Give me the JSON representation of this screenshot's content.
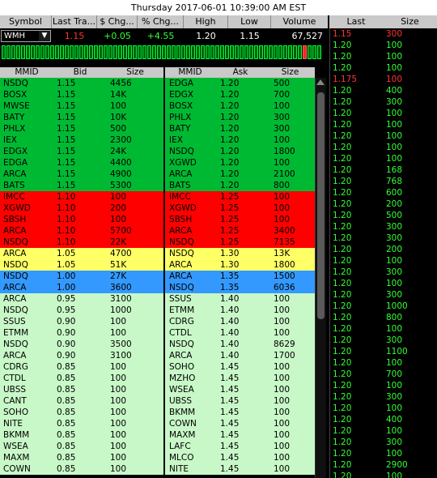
{
  "window": {
    "title": "Thursday 2017-06-01 10:39:00 AM EST"
  },
  "quote": {
    "headers": [
      "Symbol",
      "Last Tra...",
      "$ Chg...",
      "% Chg...",
      "High",
      "Low",
      "Volume"
    ],
    "symbol": "WMH",
    "last": "1.15",
    "chg": "+0.05",
    "pct": "+4.55",
    "high": "1.20",
    "low": "1.15",
    "volume": "67,527"
  },
  "colors": {
    "level1": "#00b933",
    "level2": "#ff0000",
    "level3": "#ffff66",
    "level4": "#3399ff",
    "level5": "#c8f8c8",
    "tick_green": "#00ff44",
    "tick_red": "#ff2222"
  },
  "time_sales": {
    "headers": [
      "Last",
      "Size"
    ],
    "rows": [
      {
        "last": "1.15",
        "size": "300",
        "c": "r"
      },
      {
        "last": "1.20",
        "size": "100",
        "c": "g"
      },
      {
        "last": "1.20",
        "size": "100",
        "c": "g"
      },
      {
        "last": "1.20",
        "size": "100",
        "c": "g"
      },
      {
        "last": "1.175",
        "size": "100",
        "c": "r"
      },
      {
        "last": "1.20",
        "size": "400",
        "c": "g"
      },
      {
        "last": "1.20",
        "size": "300",
        "c": "g"
      },
      {
        "last": "1.20",
        "size": "100",
        "c": "g"
      },
      {
        "last": "1.20",
        "size": "100",
        "c": "g"
      },
      {
        "last": "1.20",
        "size": "100",
        "c": "g"
      },
      {
        "last": "1.20",
        "size": "100",
        "c": "g"
      },
      {
        "last": "1.20",
        "size": "100",
        "c": "g"
      },
      {
        "last": "1.20",
        "size": "168",
        "c": "g"
      },
      {
        "last": "1.20",
        "size": "768",
        "c": "g"
      },
      {
        "last": "1.20",
        "size": "600",
        "c": "g"
      },
      {
        "last": "1.20",
        "size": "200",
        "c": "g"
      },
      {
        "last": "1.20",
        "size": "500",
        "c": "g"
      },
      {
        "last": "1.20",
        "size": "300",
        "c": "g"
      },
      {
        "last": "1.20",
        "size": "300",
        "c": "g"
      },
      {
        "last": "1.20",
        "size": "200",
        "c": "g"
      },
      {
        "last": "1.20",
        "size": "100",
        "c": "g"
      },
      {
        "last": "1.20",
        "size": "300",
        "c": "g"
      },
      {
        "last": "1.20",
        "size": "100",
        "c": "g"
      },
      {
        "last": "1.20",
        "size": "300",
        "c": "g"
      },
      {
        "last": "1.20",
        "size": "1000",
        "c": "g"
      },
      {
        "last": "1.20",
        "size": "800",
        "c": "g"
      },
      {
        "last": "1.20",
        "size": "100",
        "c": "g"
      },
      {
        "last": "1.20",
        "size": "300",
        "c": "g"
      },
      {
        "last": "1.20",
        "size": "1100",
        "c": "g"
      },
      {
        "last": "1.20",
        "size": "100",
        "c": "g"
      },
      {
        "last": "1.20",
        "size": "700",
        "c": "g"
      },
      {
        "last": "1.20",
        "size": "100",
        "c": "g"
      },
      {
        "last": "1.20",
        "size": "300",
        "c": "g"
      },
      {
        "last": "1.20",
        "size": "100",
        "c": "g"
      },
      {
        "last": "1.20",
        "size": "400",
        "c": "g"
      },
      {
        "last": "1.20",
        "size": "100",
        "c": "g"
      },
      {
        "last": "1.20",
        "size": "300",
        "c": "g"
      },
      {
        "last": "1.20",
        "size": "100",
        "c": "g"
      },
      {
        "last": "1.20",
        "size": "2900",
        "c": "g"
      },
      {
        "last": "1.20",
        "size": "100",
        "c": "g"
      }
    ]
  },
  "bid_book": {
    "headers": [
      "MMID",
      "Bid",
      "Size"
    ],
    "rows": [
      {
        "mmid": "NSDQ",
        "price": "1.15",
        "size": "4456",
        "lvl": 1
      },
      {
        "mmid": "BOSX",
        "price": "1.15",
        "size": "14K",
        "lvl": 1
      },
      {
        "mmid": "MWSE",
        "price": "1.15",
        "size": "100",
        "lvl": 1
      },
      {
        "mmid": "BATY",
        "price": "1.15",
        "size": "10K",
        "lvl": 1
      },
      {
        "mmid": "PHLX",
        "price": "1.15",
        "size": "500",
        "lvl": 1
      },
      {
        "mmid": "IEX",
        "price": "1.15",
        "size": "2300",
        "lvl": 1
      },
      {
        "mmid": "EDGX",
        "price": "1.15",
        "size": "24K",
        "lvl": 1
      },
      {
        "mmid": "EDGA",
        "price": "1.15",
        "size": "4400",
        "lvl": 1
      },
      {
        "mmid": "ARCA",
        "price": "1.15",
        "size": "4900",
        "lvl": 1
      },
      {
        "mmid": "BATS",
        "price": "1.15",
        "size": "5300",
        "lvl": 1
      },
      {
        "mmid": "IMCC",
        "price": "1.10",
        "size": "100",
        "lvl": 2
      },
      {
        "mmid": "XGWD",
        "price": "1.10",
        "size": "200",
        "lvl": 2
      },
      {
        "mmid": "SBSH",
        "price": "1.10",
        "size": "100",
        "lvl": 2
      },
      {
        "mmid": "ARCA",
        "price": "1.10",
        "size": "5700",
        "lvl": 2
      },
      {
        "mmid": "NSDQ",
        "price": "1.10",
        "size": "22K",
        "lvl": 2
      },
      {
        "mmid": "ARCA",
        "price": "1.05",
        "size": "4700",
        "lvl": 3
      },
      {
        "mmid": "NSDQ",
        "price": "1.05",
        "size": "51K",
        "lvl": 3
      },
      {
        "mmid": "NSDQ",
        "price": "1.00",
        "size": "27K",
        "lvl": 4
      },
      {
        "mmid": "ARCA",
        "price": "1.00",
        "size": "3600",
        "lvl": 4
      },
      {
        "mmid": "ARCA",
        "price": "0.95",
        "size": "3100",
        "lvl": 5
      },
      {
        "mmid": "NSDQ",
        "price": "0.95",
        "size": "1000",
        "lvl": 5
      },
      {
        "mmid": "SSUS",
        "price": "0.90",
        "size": "100",
        "lvl": 5
      },
      {
        "mmid": "ETMM",
        "price": "0.90",
        "size": "100",
        "lvl": 5
      },
      {
        "mmid": "NSDQ",
        "price": "0.90",
        "size": "3500",
        "lvl": 5
      },
      {
        "mmid": "ARCA",
        "price": "0.90",
        "size": "3100",
        "lvl": 5
      },
      {
        "mmid": "CDRG",
        "price": "0.85",
        "size": "100",
        "lvl": 5
      },
      {
        "mmid": "CTDL",
        "price": "0.85",
        "size": "100",
        "lvl": 5
      },
      {
        "mmid": "UBSS",
        "price": "0.85",
        "size": "100",
        "lvl": 5
      },
      {
        "mmid": "CANT",
        "price": "0.85",
        "size": "100",
        "lvl": 5
      },
      {
        "mmid": "SOHO",
        "price": "0.85",
        "size": "100",
        "lvl": 5
      },
      {
        "mmid": "NITE",
        "price": "0.85",
        "size": "100",
        "lvl": 5
      },
      {
        "mmid": "BKMM",
        "price": "0.85",
        "size": "100",
        "lvl": 5
      },
      {
        "mmid": "WSEA",
        "price": "0.85",
        "size": "100",
        "lvl": 5
      },
      {
        "mmid": "MAXM",
        "price": "0.85",
        "size": "100",
        "lvl": 5
      },
      {
        "mmid": "COWN",
        "price": "0.85",
        "size": "100",
        "lvl": 5
      }
    ]
  },
  "ask_book": {
    "headers": [
      "MMID",
      "Ask",
      "Size"
    ],
    "rows": [
      {
        "mmid": "EDGA",
        "price": "1.20",
        "size": "500",
        "lvl": 1
      },
      {
        "mmid": "EDGX",
        "price": "1.20",
        "size": "700",
        "lvl": 1
      },
      {
        "mmid": "BOSX",
        "price": "1.20",
        "size": "100",
        "lvl": 1
      },
      {
        "mmid": "PHLX",
        "price": "1.20",
        "size": "300",
        "lvl": 1
      },
      {
        "mmid": "BATY",
        "price": "1.20",
        "size": "300",
        "lvl": 1
      },
      {
        "mmid": "IEX",
        "price": "1.20",
        "size": "100",
        "lvl": 1
      },
      {
        "mmid": "NSDQ",
        "price": "1.20",
        "size": "1800",
        "lvl": 1
      },
      {
        "mmid": "XGWD",
        "price": "1.20",
        "size": "100",
        "lvl": 1
      },
      {
        "mmid": "ARCA",
        "price": "1.20",
        "size": "2100",
        "lvl": 1
      },
      {
        "mmid": "BATS",
        "price": "1.20",
        "size": "800",
        "lvl": 1
      },
      {
        "mmid": "IMCC",
        "price": "1.25",
        "size": "100",
        "lvl": 2
      },
      {
        "mmid": "XGWD",
        "price": "1.25",
        "size": "100",
        "lvl": 2
      },
      {
        "mmid": "SBSH",
        "price": "1.25",
        "size": "100",
        "lvl": 2
      },
      {
        "mmid": "ARCA",
        "price": "1.25",
        "size": "3400",
        "lvl": 2
      },
      {
        "mmid": "NSDQ",
        "price": "1.25",
        "size": "7135",
        "lvl": 2
      },
      {
        "mmid": "NSDQ",
        "price": "1.30",
        "size": "13K",
        "lvl": 3
      },
      {
        "mmid": "ARCA",
        "price": "1.30",
        "size": "1800",
        "lvl": 3
      },
      {
        "mmid": "ARCA",
        "price": "1.35",
        "size": "1500",
        "lvl": 4
      },
      {
        "mmid": "NSDQ",
        "price": "1.35",
        "size": "6036",
        "lvl": 4
      },
      {
        "mmid": "SSUS",
        "price": "1.40",
        "size": "100",
        "lvl": 5
      },
      {
        "mmid": "ETMM",
        "price": "1.40",
        "size": "100",
        "lvl": 5
      },
      {
        "mmid": "CDRG",
        "price": "1.40",
        "size": "100",
        "lvl": 5
      },
      {
        "mmid": "CTDL",
        "price": "1.40",
        "size": "100",
        "lvl": 5
      },
      {
        "mmid": "NSDQ",
        "price": "1.40",
        "size": "8629",
        "lvl": 5
      },
      {
        "mmid": "ARCA",
        "price": "1.40",
        "size": "1700",
        "lvl": 5
      },
      {
        "mmid": "SOHO",
        "price": "1.45",
        "size": "100",
        "lvl": 5
      },
      {
        "mmid": "MZHO",
        "price": "1.45",
        "size": "100",
        "lvl": 5
      },
      {
        "mmid": "WSEA",
        "price": "1.45",
        "size": "100",
        "lvl": 5
      },
      {
        "mmid": "UBSS",
        "price": "1.45",
        "size": "100",
        "lvl": 5
      },
      {
        "mmid": "BKMM",
        "price": "1.45",
        "size": "100",
        "lvl": 5
      },
      {
        "mmid": "COWN",
        "price": "1.45",
        "size": "100",
        "lvl": 5
      },
      {
        "mmid": "MAXM",
        "price": "1.45",
        "size": "100",
        "lvl": 5
      },
      {
        "mmid": "LAFC",
        "price": "1.45",
        "size": "100",
        "lvl": 5
      },
      {
        "mmid": "MLCO",
        "price": "1.45",
        "size": "100",
        "lvl": 5
      },
      {
        "mmid": "NITE",
        "price": "1.45",
        "size": "100",
        "lvl": 5
      }
    ]
  },
  "tick_bar": {
    "ticks": [
      "g",
      "g",
      "g",
      "g",
      "g",
      "g",
      "g",
      "g",
      "g",
      "g",
      "g",
      "g",
      "g",
      "g",
      "g",
      "g",
      "g",
      "g",
      "g",
      "g",
      "g",
      "g",
      "g",
      "g",
      "g",
      "g",
      "g",
      "g",
      "g",
      "g",
      "g",
      "g",
      "g",
      "g",
      "g",
      "g",
      "g",
      "g",
      "g",
      "g",
      "g",
      "g",
      "g",
      "g",
      "g",
      "g",
      "g",
      "g",
      "g",
      "g",
      "g",
      "g",
      "g",
      "g",
      "g",
      "g",
      "g",
      "g",
      "g",
      "g",
      "g",
      "g",
      "r",
      "g",
      "g",
      "g"
    ]
  }
}
